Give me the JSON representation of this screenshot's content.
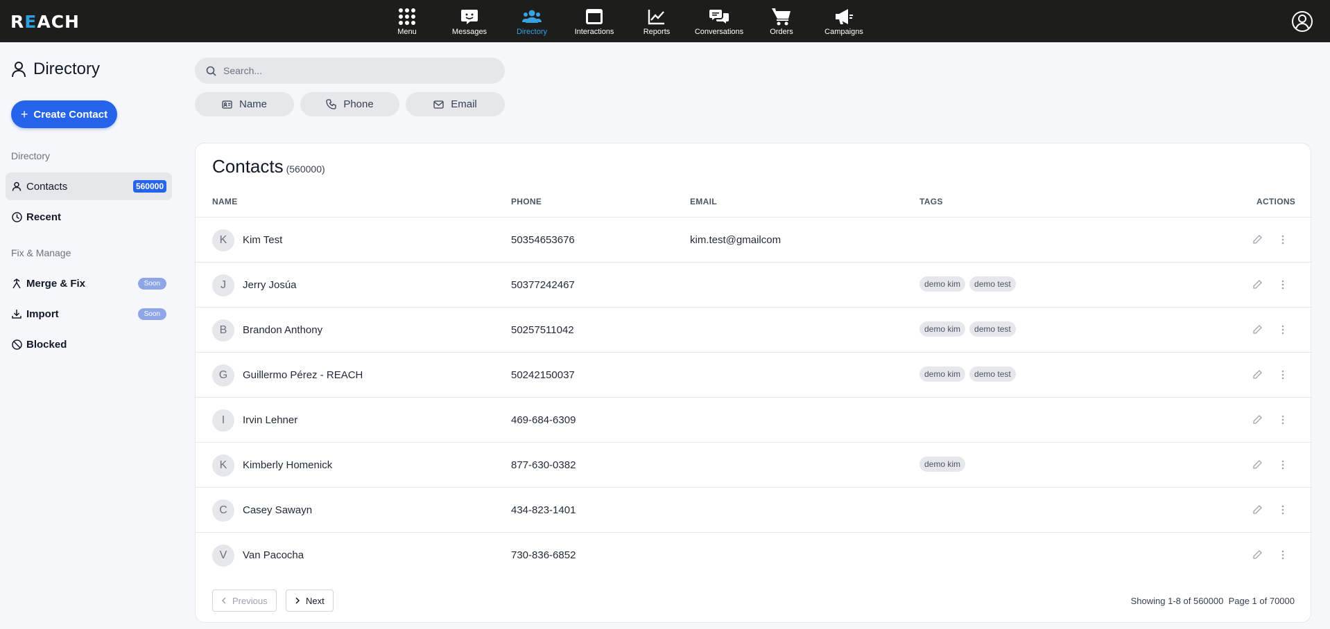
{
  "app": {
    "logo_prefix": "R",
    "logo_accent": "E",
    "logo_suffix": "ACH"
  },
  "nav": [
    {
      "label": "Menu",
      "icon": "grid-dots-icon",
      "active": false
    },
    {
      "label": "Messages",
      "icon": "message-smile-icon",
      "active": false
    },
    {
      "label": "Directory",
      "icon": "users-icon",
      "active": true
    },
    {
      "label": "Interactions",
      "icon": "window-icon",
      "active": false
    },
    {
      "label": "Reports",
      "icon": "chart-line-icon",
      "active": false
    },
    {
      "label": "Conversations",
      "icon": "chat-bubbles-icon",
      "active": false
    },
    {
      "label": "Orders",
      "icon": "cart-icon",
      "active": false
    },
    {
      "label": "Campaigns",
      "icon": "megaphone-icon",
      "active": false
    }
  ],
  "sidebar": {
    "title": "Directory",
    "create_label": "Create Contact",
    "section_directory": "Directory",
    "contacts_label": "Contacts",
    "contacts_count": "560000",
    "recent_label": "Recent",
    "section_fix": "Fix & Manage",
    "merge_label": "Merge & Fix",
    "import_label": "Import",
    "soon_label": "Soon",
    "blocked_label": "Blocked"
  },
  "search": {
    "placeholder": "Search..."
  },
  "filters": {
    "name": "Name",
    "phone": "Phone",
    "email": "Email"
  },
  "contacts": {
    "title": "Contacts",
    "count": "(560000)",
    "columns": {
      "name": "NAME",
      "phone": "PHONE",
      "email": "EMAIL",
      "tags": "TAGS",
      "actions": "ACTIONS"
    },
    "rows": [
      {
        "initial": "K",
        "name": "Kim Test",
        "phone": "50354653676",
        "email": "kim.test@gmailcom",
        "tags": []
      },
      {
        "initial": "J",
        "name": "Jerry Josúa",
        "phone": "50377242467",
        "email": "",
        "tags": [
          "demo kim",
          "demo test"
        ]
      },
      {
        "initial": "B",
        "name": "Brandon Anthony",
        "phone": "50257511042",
        "email": "",
        "tags": [
          "demo kim",
          "demo test"
        ]
      },
      {
        "initial": "G",
        "name": "Guillermo Pérez - REACH",
        "phone": "50242150037",
        "email": "",
        "tags": [
          "demo kim",
          "demo test"
        ]
      },
      {
        "initial": "I",
        "name": "Irvin Lehner",
        "phone": "469-684-6309",
        "email": "",
        "tags": []
      },
      {
        "initial": "K",
        "name": "Kimberly Homenick",
        "phone": "877-630-0382",
        "email": "",
        "tags": [
          "demo kim"
        ]
      },
      {
        "initial": "C",
        "name": "Casey Sawayn",
        "phone": "434-823-1401",
        "email": "",
        "tags": []
      },
      {
        "initial": "V",
        "name": "Van Pacocha",
        "phone": "730-836-6852",
        "email": "",
        "tags": []
      }
    ],
    "pager": {
      "previous": "Previous",
      "next": "Next",
      "showing": "Showing 1-8 of 560000",
      "page": "Page 1 of 70000"
    }
  },
  "colors": {
    "topbar": "#1d1d1b",
    "accent": "#2563eb",
    "nav_active": "#36a3e3",
    "soon": "#8ea5e8"
  }
}
